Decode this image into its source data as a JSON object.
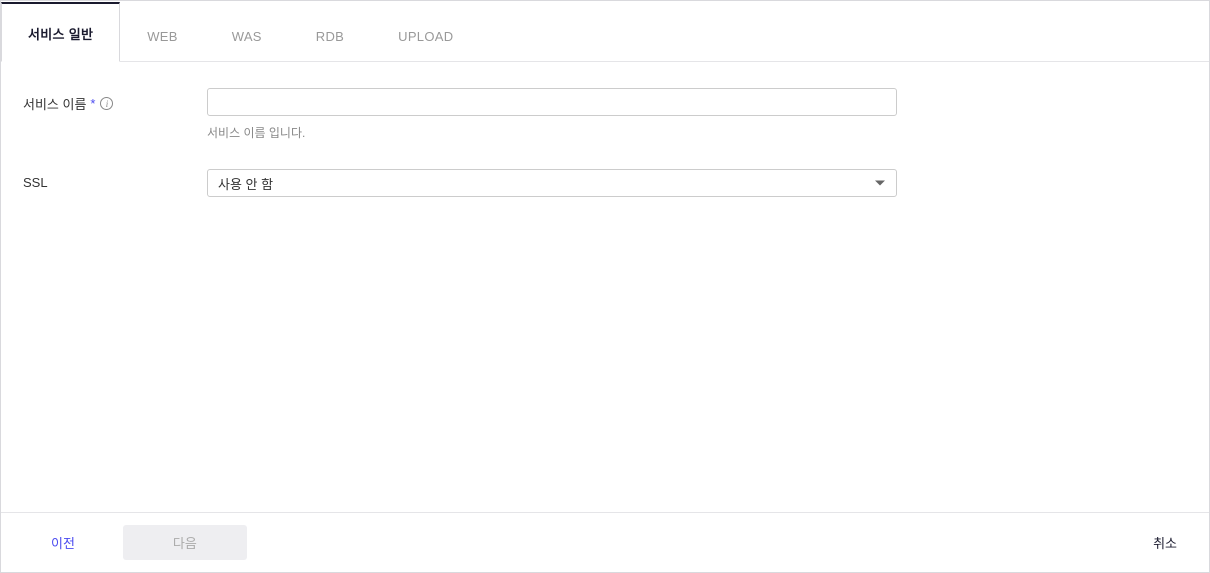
{
  "tabs": [
    {
      "label": "서비스 일반",
      "active": true
    },
    {
      "label": "WEB",
      "active": false
    },
    {
      "label": "WAS",
      "active": false
    },
    {
      "label": "RDB",
      "active": false
    },
    {
      "label": "UPLOAD",
      "active": false
    }
  ],
  "form": {
    "serviceName": {
      "label": "서비스 이름",
      "value": "",
      "helper": "서비스 이름 입니다.",
      "required": true
    },
    "ssl": {
      "label": "SSL",
      "selected": "사용 안 함"
    }
  },
  "footer": {
    "prev": "이전",
    "next": "다음",
    "cancel": "취소"
  }
}
